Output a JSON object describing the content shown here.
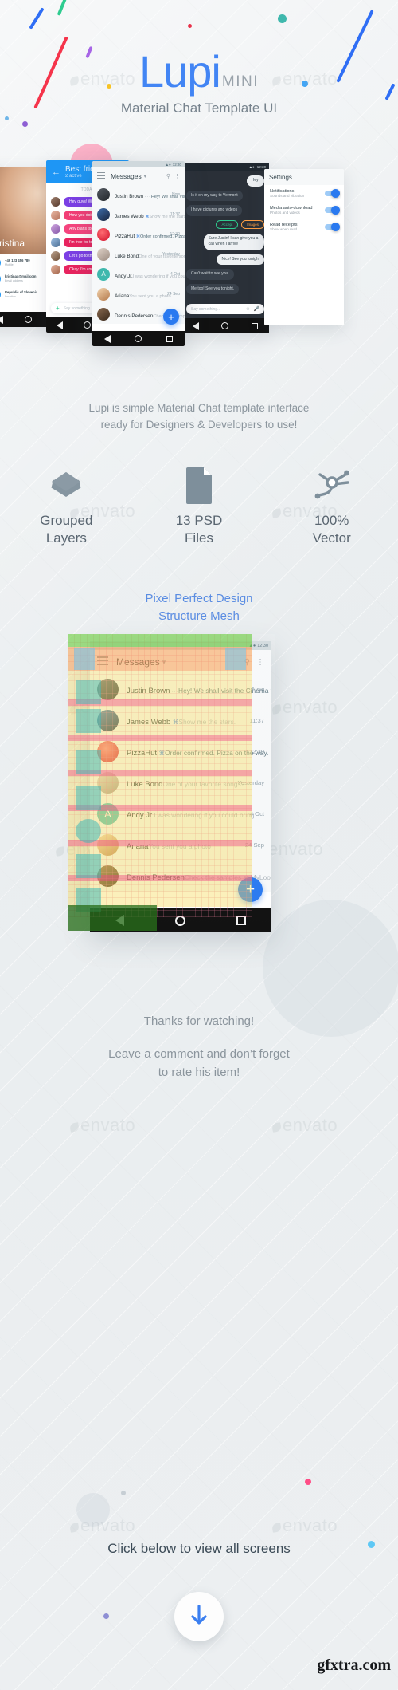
{
  "brand": {
    "title": "Lupi",
    "sub": "MINI",
    "tagline": "Material Chat Template UI",
    "accent": "#4285f4"
  },
  "watermark": {
    "text": "envato",
    "gfxtra": "gfxtra.com"
  },
  "description": "Lupi is simple Material Chat template interface\nready for Designers & Developers to use!",
  "features": [
    {
      "icon": "layers-icon",
      "label": "Grouped\nLayers"
    },
    {
      "icon": "document-icon",
      "label": "13 PSD\nFiles"
    },
    {
      "icon": "vector-node-icon",
      "label": "100%\nVector"
    }
  ],
  "pixel_perfect": {
    "line1": "Pixel Perfect Design",
    "line2": "Structure Mesh"
  },
  "messages_screen": {
    "status_time": "12:30",
    "title": "Messages",
    "caret": "▾",
    "menu_icon": "hamburger-icon",
    "search_icon": "search-icon",
    "overflow_icon": "more-vert-icon",
    "fab_label": "+",
    "conversations": [
      {
        "name": "Justin Brown",
        "badge": "",
        "dots": "···",
        "preview": "Hey! We shall visit the Cinema toni...",
        "time": "Now",
        "read": false,
        "avatar_color": "#3a3f45"
      },
      {
        "name": "James Webb",
        "badge": "⌘",
        "dots": "",
        "preview": "Show me the stars.",
        "time": "11:37",
        "read": true,
        "avatar_color": "#2b4b7a"
      },
      {
        "name": "PizzaHut",
        "badge": "⌘",
        "dots": "",
        "preview": "Order confirmed. Pizza on the way.",
        "time": "12:30",
        "read": false,
        "avatar_color": "#e8314a"
      },
      {
        "name": "Luke Bond",
        "badge": "",
        "dots": "",
        "preview": "One of your favorite songs?",
        "time": "Yesterday",
        "read": true,
        "avatar_color": "#b9a79c"
      },
      {
        "name": "Andy Jr.",
        "badge": "",
        "dots": "",
        "preview": "I was wondering if you could bring...",
        "time": "4 Oct",
        "read": true,
        "avatar_color": "#3fb8ad",
        "initial": "A"
      },
      {
        "name": "Ariana",
        "badge": "",
        "dots": "",
        "preview": "You sent you a photo",
        "time": "24 Sep",
        "read": true,
        "avatar_color": "#d9a678"
      },
      {
        "name": "Dennis Pedersen",
        "badge": "",
        "dots": "",
        "preview": "Check the samples at MyLoops",
        "time": "",
        "read": true,
        "avatar_color": "#5a4638"
      }
    ]
  },
  "profile_screen": {
    "back_icon": "arrow-back-icon",
    "name": "Kristina",
    "rows": [
      {
        "icon": "phone-icon",
        "title": "+49 123 456 789",
        "sub": "Mobile"
      },
      {
        "icon": "mail-icon",
        "title": "kristinax@mail.com",
        "sub": "Email address"
      },
      {
        "icon": "place-icon",
        "title": "Republic of Slovenia",
        "sub": "Location"
      }
    ]
  },
  "group_screen": {
    "back_icon": "arrow-back-icon",
    "title": "Best friends",
    "subtitle": "2 active",
    "day": "TODAY",
    "bubbles": [
      {
        "text": "Hey guys! What's up?",
        "style": "purple"
      },
      {
        "text": "How you doing?",
        "style": "pink"
      },
      {
        "text": "Any plans tonight?",
        "style": "pink2"
      },
      {
        "text": "I'm free for tonight.",
        "style": "crimson"
      },
      {
        "text": "Let's go to the cinema",
        "style": "purple"
      },
      {
        "text": "Okay. I'm coming!",
        "style": "crimson"
      }
    ],
    "input_placeholder": "Say something...",
    "plus_icon": "plus-icon"
  },
  "dark_screen": {
    "status_time": "12:30",
    "bubbles": [
      {
        "text": "Hey!",
        "side": "right"
      },
      {
        "text": "Is it on my way to Vermont",
        "side": "left"
      },
      {
        "text": "I have pictures and videos",
        "side": "left"
      },
      {
        "text": "Sure Justin! I can give you a call when I arrive",
        "side": "right"
      },
      {
        "text": "Nice! See you tonight",
        "side": "right"
      },
      {
        "text": "Can't wait to see you.",
        "side": "left"
      },
      {
        "text": "Me too! See you tonight.",
        "side": "left"
      }
    ],
    "chips": [
      {
        "label": "Accept",
        "style": "green"
      },
      {
        "label": "Images",
        "style": "orange"
      }
    ],
    "input_placeholder": "Say something...",
    "emoji_icon": "emoji-icon",
    "mic_icon": "mic-icon"
  },
  "settings_screen": {
    "title": "Settings",
    "rows": [
      {
        "title": "Notifications",
        "sub": "Sounds and vibration",
        "toggle": true
      },
      {
        "title": "Media auto-download",
        "sub": "Photos and videos",
        "toggle": true
      },
      {
        "title": "Read receipts",
        "sub": "Show when read",
        "toggle": true
      }
    ]
  },
  "footer": {
    "thanks": "Thanks for watching!",
    "rate": "Leave a comment and don’t forget\nto rate his item!",
    "cta_text": "Click below to view all screens",
    "cta_icon": "arrow-down-icon"
  },
  "android_nav": {
    "back_icon": "nav-back-icon",
    "home_icon": "nav-home-icon",
    "recents_icon": "nav-recents-icon"
  }
}
